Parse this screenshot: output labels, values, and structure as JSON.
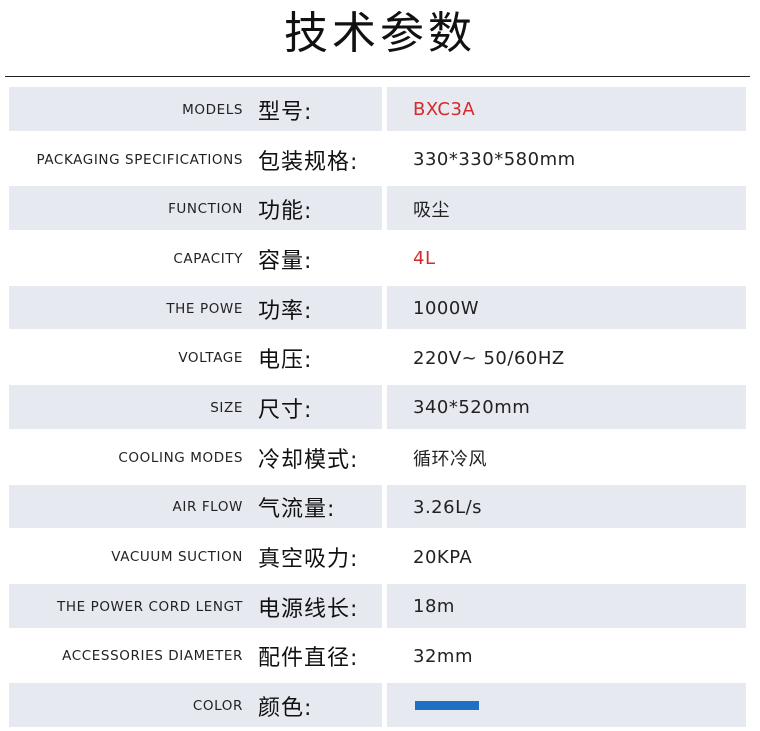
{
  "title": "技术参数",
  "colors": {
    "shade": "#e6e9f0",
    "highlight": "#d42a2a",
    "swatch": "#1f6fc2"
  },
  "rows": [
    {
      "en": "MODELS",
      "zh": "型号:",
      "value": "BXC3A"
    },
    {
      "en": "PACKAGING SPECIFICATIONS",
      "zh": "包装规格:",
      "value": "330*330*580mm"
    },
    {
      "en": "FUNCTION",
      "zh": "功能:",
      "value": "吸尘"
    },
    {
      "en": "CAPACITY",
      "zh": "容量:",
      "value": "4L"
    },
    {
      "en": "THE POWE",
      "zh": "功率:",
      "value": "1000W"
    },
    {
      "en": "VOLTAGE",
      "zh": "电压:",
      "value": "220V~ 50/60HZ"
    },
    {
      "en": "SIZE",
      "zh": "尺寸:",
      "value": "340*520mm"
    },
    {
      "en": "COOLING MODES",
      "zh": "冷却模式:",
      "value": "循环冷风"
    },
    {
      "en": "AIR FLOW",
      "zh": "气流量:",
      "value": "3.26L/s"
    },
    {
      "en": "VACUUM SUCTION",
      "zh": "真空吸力:",
      "value": "20KPA"
    },
    {
      "en": "THE POWER CORD LENGT",
      "zh": "电源线长:",
      "value": "18m"
    },
    {
      "en": "ACCESSORIES DIAMETER",
      "zh": "配件直径:",
      "value": "32mm"
    },
    {
      "en": "COLOR",
      "zh": "颜色:",
      "value": "",
      "swatch_color": "blue"
    }
  ]
}
